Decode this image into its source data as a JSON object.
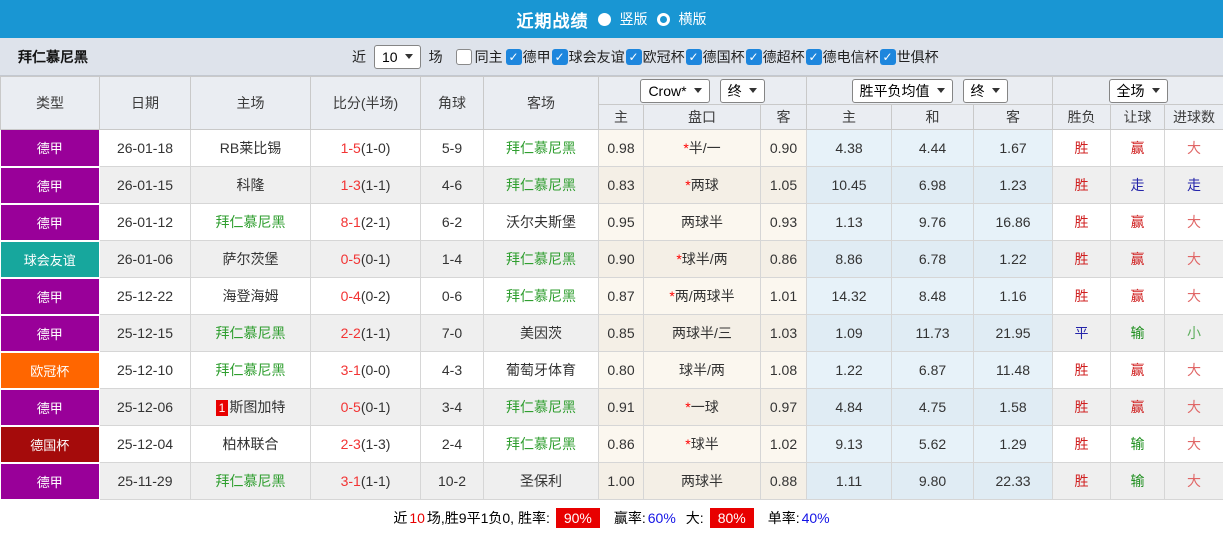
{
  "title_bar": {
    "title": "近期战绩",
    "vertical_label": "竖版",
    "horizontal_label": "横版"
  },
  "filter_bar": {
    "team": "拜仁慕尼黑",
    "recent_label": "近",
    "recent_value": "10",
    "matches_label": "场",
    "same_home_label": "同主",
    "leagues": [
      "德甲",
      "球会友谊",
      "欧冠杯",
      "德国杯",
      "德超杯",
      "德电信杯",
      "世俱杯"
    ]
  },
  "table": {
    "left_headers": [
      "类型",
      "日期",
      "主场",
      "比分(半场)",
      "角球",
      "客场"
    ],
    "dropdowns": {
      "odds_source": "Crow*",
      "odds_time1": "终",
      "avg_type": "胜平负均值",
      "avg_time": "终",
      "scope": "全场"
    },
    "sub_headers": [
      "主",
      "盘口",
      "客",
      "主",
      "和",
      "客",
      "胜负",
      "让球",
      "进球数"
    ],
    "rows": [
      {
        "type": "德甲",
        "date": "26-01-18",
        "home": "RB莱比锡",
        "home_green": false,
        "home_rank": "",
        "score": "1-5",
        "half": "(1-0)",
        "corners": "5-9",
        "away": "拜仁慕尼黑",
        "away_green": true,
        "odds_home": "0.98",
        "handicap_star": true,
        "handicap": "半/一",
        "odds_away": "0.90",
        "avg_win": "4.38",
        "avg_draw": "4.44",
        "avg_lose": "1.67",
        "result": "胜",
        "result_color": "red",
        "let_result": "赢",
        "let_color": "red",
        "goal_result": "大",
        "goal_color": "lightred"
      },
      {
        "type": "德甲",
        "date": "26-01-15",
        "home": "科隆",
        "home_green": false,
        "home_rank": "",
        "score": "1-3",
        "half": "(1-1)",
        "corners": "4-6",
        "away": "拜仁慕尼黑",
        "away_green": true,
        "odds_home": "0.83",
        "handicap_star": true,
        "handicap": "两球",
        "odds_away": "1.05",
        "avg_win": "10.45",
        "avg_draw": "6.98",
        "avg_lose": "1.23",
        "result": "胜",
        "result_color": "red",
        "let_result": "走",
        "let_color": "blue",
        "goal_result": "走",
        "goal_color": "blue"
      },
      {
        "type": "德甲",
        "date": "26-01-12",
        "home": "拜仁慕尼黑",
        "home_green": true,
        "home_rank": "",
        "score": "8-1",
        "half": "(2-1)",
        "corners": "6-2",
        "away": "沃尔夫斯堡",
        "away_green": false,
        "odds_home": "0.95",
        "handicap_star": false,
        "handicap": "两球半",
        "odds_away": "0.93",
        "avg_win": "1.13",
        "avg_draw": "9.76",
        "avg_lose": "16.86",
        "result": "胜",
        "result_color": "red",
        "let_result": "赢",
        "let_color": "red",
        "goal_result": "大",
        "goal_color": "lightred"
      },
      {
        "type": "球会友谊",
        "date": "26-01-06",
        "home": "萨尔茨堡",
        "home_green": false,
        "home_rank": "",
        "score": "0-5",
        "half": "(0-1)",
        "corners": "1-4",
        "away": "拜仁慕尼黑",
        "away_green": true,
        "odds_home": "0.90",
        "handicap_star": true,
        "handicap": "球半/两",
        "odds_away": "0.86",
        "avg_win": "8.86",
        "avg_draw": "6.78",
        "avg_lose": "1.22",
        "result": "胜",
        "result_color": "red",
        "let_result": "赢",
        "let_color": "red",
        "goal_result": "大",
        "goal_color": "lightred"
      },
      {
        "type": "德甲",
        "date": "25-12-22",
        "home": "海登海姆",
        "home_green": false,
        "home_rank": "",
        "score": "0-4",
        "half": "(0-2)",
        "corners": "0-6",
        "away": "拜仁慕尼黑",
        "away_green": true,
        "odds_home": "0.87",
        "handicap_star": true,
        "handicap": "两/两球半",
        "odds_away": "1.01",
        "avg_win": "14.32",
        "avg_draw": "8.48",
        "avg_lose": "1.16",
        "result": "胜",
        "result_color": "red",
        "let_result": "赢",
        "let_color": "red",
        "goal_result": "大",
        "goal_color": "lightred"
      },
      {
        "type": "德甲",
        "date": "25-12-15",
        "home": "拜仁慕尼黑",
        "home_green": true,
        "home_rank": "",
        "score": "2-2",
        "half": "(1-1)",
        "corners": "7-0",
        "away": "美因茨",
        "away_green": false,
        "odds_home": "0.85",
        "handicap_star": false,
        "handicap": "两球半/三",
        "odds_away": "1.03",
        "avg_win": "1.09",
        "avg_draw": "11.73",
        "avg_lose": "21.95",
        "result": "平",
        "result_color": "blue",
        "let_result": "输",
        "let_color": "green",
        "goal_result": "小",
        "goal_color": "lightgreen"
      },
      {
        "type": "欧冠杯",
        "date": "25-12-10",
        "home": "拜仁慕尼黑",
        "home_green": true,
        "home_rank": "",
        "score": "3-1",
        "half": "(0-0)",
        "corners": "4-3",
        "away": "葡萄牙体育",
        "away_green": false,
        "odds_home": "0.80",
        "handicap_star": false,
        "handicap": "球半/两",
        "odds_away": "1.08",
        "avg_win": "1.22",
        "avg_draw": "6.87",
        "avg_lose": "11.48",
        "result": "胜",
        "result_color": "red",
        "let_result": "赢",
        "let_color": "red",
        "goal_result": "大",
        "goal_color": "lightred"
      },
      {
        "type": "德甲",
        "date": "25-12-06",
        "home": "斯图加特",
        "home_green": false,
        "home_rank": "1",
        "score": "0-5",
        "half": "(0-1)",
        "corners": "3-4",
        "away": "拜仁慕尼黑",
        "away_green": true,
        "odds_home": "0.91",
        "handicap_star": true,
        "handicap": "一球",
        "odds_away": "0.97",
        "avg_win": "4.84",
        "avg_draw": "4.75",
        "avg_lose": "1.58",
        "result": "胜",
        "result_color": "red",
        "let_result": "赢",
        "let_color": "red",
        "goal_result": "大",
        "goal_color": "lightred"
      },
      {
        "type": "德国杯",
        "date": "25-12-04",
        "home": "柏林联合",
        "home_green": false,
        "home_rank": "",
        "score": "2-3",
        "half": "(1-3)",
        "corners": "2-4",
        "away": "拜仁慕尼黑",
        "away_green": true,
        "odds_home": "0.86",
        "handicap_star": true,
        "handicap": "球半",
        "odds_away": "1.02",
        "avg_win": "9.13",
        "avg_draw": "5.62",
        "avg_lose": "1.29",
        "result": "胜",
        "result_color": "red",
        "let_result": "输",
        "let_color": "green",
        "goal_result": "大",
        "goal_color": "lightred"
      },
      {
        "type": "德甲",
        "date": "25-11-29",
        "home": "拜仁慕尼黑",
        "home_green": true,
        "home_rank": "",
        "score": "3-1",
        "half": "(1-1)",
        "corners": "10-2",
        "away": "圣保利",
        "away_green": false,
        "odds_home": "1.00",
        "handicap_star": false,
        "handicap": "两球半",
        "odds_away": "0.88",
        "avg_win": "1.11",
        "avg_draw": "9.80",
        "avg_lose": "22.33",
        "result": "胜",
        "result_color": "red",
        "let_result": "输",
        "let_color": "green",
        "goal_result": "大",
        "goal_color": "lightred"
      }
    ]
  },
  "summary": {
    "recent_label": "近",
    "recent_count": "10",
    "record_text": "场,胜9平1负0, 胜率:",
    "win_rate": "90%",
    "odds_win_label": "赢率:",
    "odds_win_rate": "60%",
    "big_label": "大:",
    "big_rate": "80%",
    "single_label": "单率:",
    "single_rate": "40%"
  },
  "colors": {
    "accent_blue": "#1996d3",
    "type_badges": {
      "德甲": "#990099",
      "球会友谊": "#17a79d",
      "欧冠杯": "#ff6600",
      "德国杯": "#a50b0b"
    },
    "result_red": "#d02020",
    "result_blue": "#2525aa",
    "result_green": "#1f8f1f",
    "light_red": "#e06666",
    "light_green": "#5fae5f",
    "team_green": "#2f9e2f",
    "score_red": "#f23333",
    "rate_badge_bg": "#e80000",
    "rate_blue": "#1414e6"
  }
}
